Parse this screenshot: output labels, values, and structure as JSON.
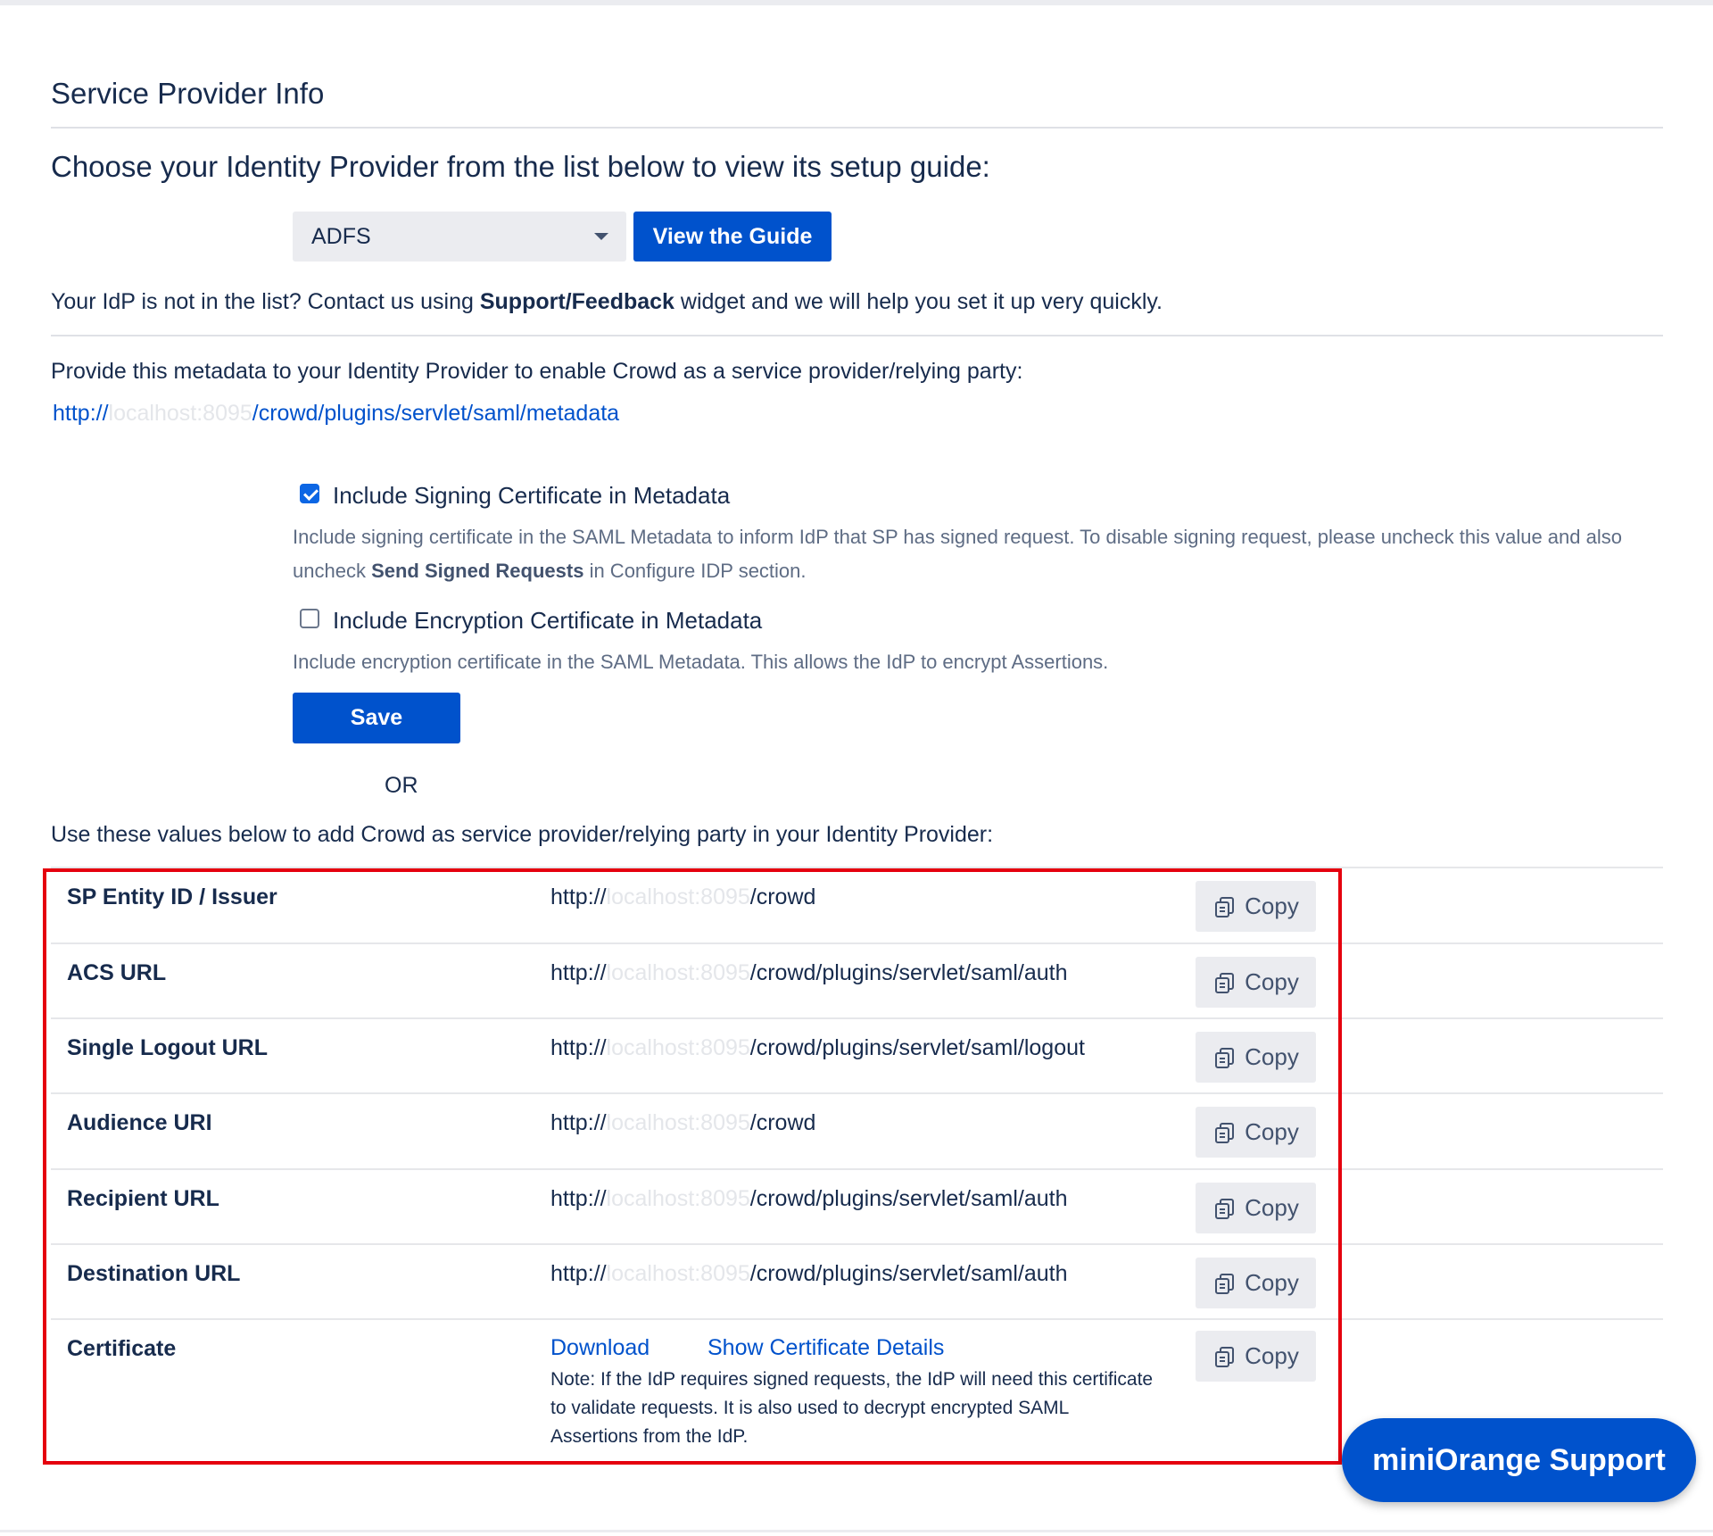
{
  "header": {
    "title": "Service Provider Info"
  },
  "idp_selector": {
    "heading": "Choose your Identity Provider from the list below to view its setup guide:",
    "selected": "ADFS",
    "view_guide_label": "View the Guide",
    "help_prefix": "Your IdP is not in the list? Contact us using ",
    "help_bold": "Support/Feedback",
    "help_suffix": " widget and we will help you set it up very quickly."
  },
  "metadata": {
    "provide_text": "Provide this metadata to your Identity Provider to enable Crowd as a service provider/relying party:",
    "link_scheme": "http://",
    "link_host": "localhost:8095",
    "link_path": "/crowd/plugins/servlet/saml/metadata"
  },
  "options": {
    "signing": {
      "label": "Include Signing Certificate in Metadata",
      "checked": true,
      "desc_prefix": "Include signing certificate in the SAML Metadata to inform IdP that SP has signed request. To disable signing request, please uncheck this value and also uncheck ",
      "desc_bold": "Send Signed Requests",
      "desc_suffix": " in Configure IDP section."
    },
    "encryption": {
      "label": "Include Encryption Certificate in Metadata",
      "checked": false,
      "desc": "Include encryption certificate in the SAML Metadata. This allows the IdP to encrypt Assertions."
    },
    "save_label": "Save",
    "or_label": "OR"
  },
  "values": {
    "intro": "Use these values below to add Crowd as service provider/relying party in your Identity Provider:",
    "copy_label": "Copy",
    "rows": [
      {
        "label": "SP Entity ID / Issuer",
        "scheme": "http://",
        "host": "localhost:8095",
        "path": "/crowd"
      },
      {
        "label": "ACS URL",
        "scheme": "http://",
        "host": "localhost:8095",
        "path": "/crowd/plugins/servlet/saml/auth"
      },
      {
        "label": "Single Logout URL",
        "scheme": "http://",
        "host": "localhost:8095",
        "path": "/crowd/plugins/servlet/saml/logout"
      },
      {
        "label": "Audience URI",
        "scheme": "http://",
        "host": "localhost:8095",
        "path": "/crowd"
      },
      {
        "label": "Recipient URL",
        "scheme": "http://",
        "host": "localhost:8095",
        "path": "/crowd/plugins/servlet/saml/auth"
      },
      {
        "label": "Destination URL",
        "scheme": "http://",
        "host": "localhost:8095",
        "path": "/crowd/plugins/servlet/saml/auth"
      }
    ],
    "certificate": {
      "label": "Certificate",
      "download_label": "Download",
      "details_label": "Show Certificate Details",
      "note": "Note: If the IdP requires signed requests, the IdP will need this certificate to validate requests. It is also used to decrypt encrypted SAML Assertions from the IdP."
    }
  },
  "support": {
    "label": "miniOrange Support"
  },
  "colors": {
    "primary": "#0052cc",
    "highlight": "#e5000e",
    "text": "#172b4d",
    "muted": "#5e6c84"
  }
}
